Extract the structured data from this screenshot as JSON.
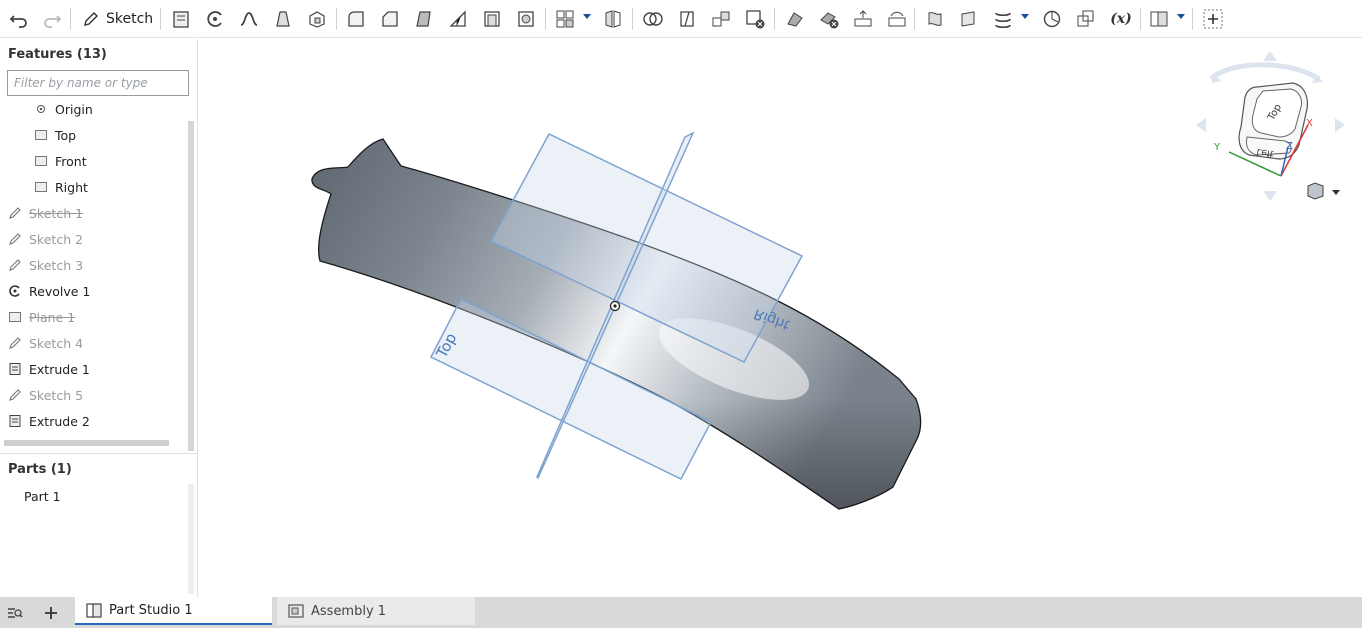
{
  "toolbar": {
    "sketch_label": "Sketch"
  },
  "features": {
    "title": "Features (13)",
    "filter_placeholder": "Filter by name or type",
    "items": [
      {
        "label": "Origin",
        "icon": "origin-icon",
        "state": "normal"
      },
      {
        "label": "Top",
        "icon": "plane-icon",
        "state": "normal"
      },
      {
        "label": "Front",
        "icon": "plane-icon",
        "state": "normal"
      },
      {
        "label": "Right",
        "icon": "plane-icon",
        "state": "normal"
      },
      {
        "label": "Sketch 1",
        "icon": "sketch-icon",
        "state": "suppressed"
      },
      {
        "label": "Sketch 2",
        "icon": "sketch-icon",
        "state": "dim"
      },
      {
        "label": "Sketch 3",
        "icon": "sketch-icon",
        "state": "dim"
      },
      {
        "label": "Revolve 1",
        "icon": "revolve-icon",
        "state": "normal"
      },
      {
        "label": "Plane 1",
        "icon": "plane-icon",
        "state": "suppressed"
      },
      {
        "label": "Sketch 4",
        "icon": "sketch-icon",
        "state": "dim"
      },
      {
        "label": "Extrude 1",
        "icon": "extrude-icon",
        "state": "normal"
      },
      {
        "label": "Sketch 5",
        "icon": "sketch-icon",
        "state": "dim"
      },
      {
        "label": "Extrude 2",
        "icon": "extrude-icon",
        "state": "normal"
      }
    ]
  },
  "parts": {
    "title": "Parts (1)",
    "items": [
      "Part 1"
    ]
  },
  "viewport": {
    "plane_labels": {
      "top": "Top",
      "right": "Right"
    },
    "view_cube": {
      "top_face": "Top",
      "left_face": "Left",
      "axes": {
        "x": "X",
        "y": "Y",
        "z": "Z"
      }
    }
  },
  "tabs": [
    {
      "label": "Part Studio 1",
      "active": true
    },
    {
      "label": "Assembly 1",
      "active": false
    }
  ],
  "colors": {
    "accent": "#2b64c8",
    "plane_fill": "#c8d8ea",
    "plane_stroke": "#7fa3cf",
    "axis_x": "#e03030",
    "axis_y": "#2f9a2f",
    "axis_z": "#2b64c8"
  }
}
